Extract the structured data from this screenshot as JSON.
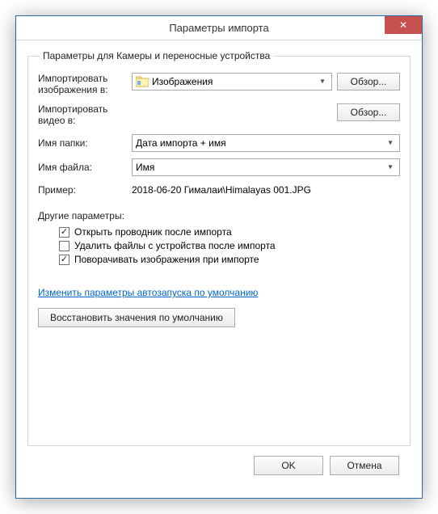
{
  "window": {
    "title": "Параметры импорта",
    "close_symbol": "✕"
  },
  "group": {
    "legend": "Параметры для Камеры и переносные устройства"
  },
  "rows": {
    "import_images": {
      "label": "Импортировать изображения в:",
      "value": "Изображения",
      "browse": "Обзор..."
    },
    "import_video": {
      "label": "Импортировать видео в:",
      "browse": "Обзор..."
    },
    "folder_name": {
      "label": "Имя папки:",
      "value": "Дата импорта + имя"
    },
    "file_name": {
      "label": "Имя файла:",
      "value": "Имя"
    },
    "example": {
      "label": "Пример:",
      "value": "2018-06-20 Гималаи\\Himalayas 001.JPG"
    }
  },
  "other": {
    "heading": "Другие параметры:",
    "opt_open_explorer": "Открыть проводник после импорта",
    "opt_delete_after": "Удалить файлы с устройства после импорта",
    "opt_rotate": "Поворачивать изображения при импорте"
  },
  "link_autorun": "Изменить параметры автозапуска по умолчанию",
  "restore_defaults": "Восстановить значения по умолчанию",
  "footer": {
    "ok": "OK",
    "cancel": "Отмена"
  },
  "checks": {
    "open_explorer": true,
    "delete_after": false,
    "rotate": true
  }
}
